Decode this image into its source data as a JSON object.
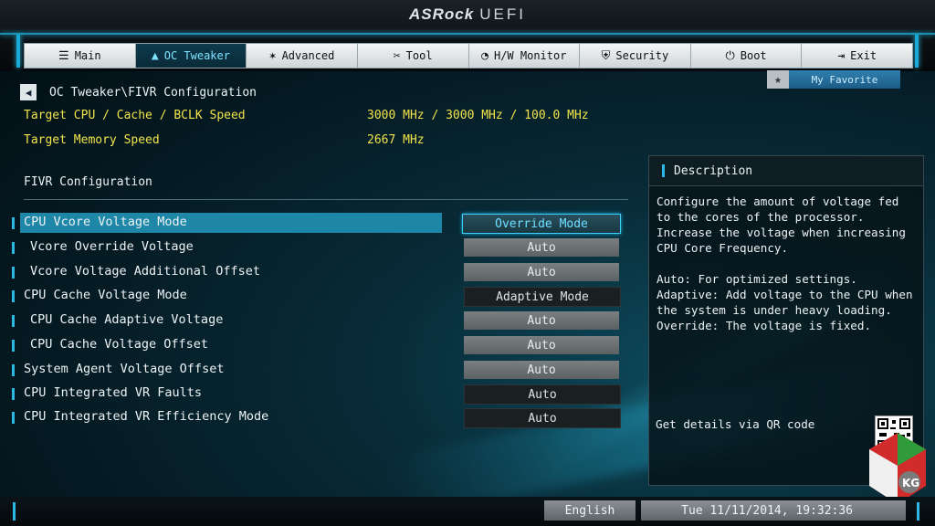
{
  "brand": {
    "logo_text": "ASRock",
    "product": "UEFI"
  },
  "tabs": [
    {
      "label": "Main",
      "icon": "list-icon",
      "glyph": "☰"
    },
    {
      "label": "OC Tweaker",
      "icon": "rocket-icon",
      "glyph": "🚀",
      "active": true
    },
    {
      "label": "Advanced",
      "icon": "star-icon",
      "glyph": "✶"
    },
    {
      "label": "Tool",
      "icon": "tools-icon",
      "glyph": "✂"
    },
    {
      "label": "H/W Monitor",
      "icon": "monitor-icon",
      "glyph": "◔"
    },
    {
      "label": "Security",
      "icon": "shield-icon",
      "glyph": "⛨"
    },
    {
      "label": "Boot",
      "icon": "power-icon",
      "glyph": "⏻"
    },
    {
      "label": "Exit",
      "icon": "exit-icon",
      "glyph": "⇥"
    }
  ],
  "favorite": {
    "label": "My Favorite",
    "icon": "star-icon"
  },
  "breadcrumb": "OC Tweaker\\FIVR Configuration",
  "info": [
    {
      "label": "Target CPU / Cache / BCLK Speed",
      "value": "3000 MHz / 3000 MHz / 100.0 MHz"
    },
    {
      "label": "Target Memory Speed",
      "value": "2667 MHz"
    }
  ],
  "section_title": "FIVR Configuration",
  "settings": [
    {
      "label": "CPU Vcore Voltage Mode",
      "value": "Override Mode"
    },
    {
      "label": "Vcore Override Voltage",
      "value": "Auto"
    },
    {
      "label": "Vcore Voltage Additional Offset",
      "value": "Auto"
    },
    {
      "label": "CPU Cache Voltage Mode",
      "value": "Adaptive Mode"
    },
    {
      "label": "CPU Cache Adaptive Voltage",
      "value": "Auto"
    },
    {
      "label": "CPU Cache Voltage Offset",
      "value": "Auto"
    },
    {
      "label": "System Agent Voltage Offset",
      "value": "Auto"
    },
    {
      "label": "CPU Integrated VR Faults",
      "value": "Auto"
    },
    {
      "label": "CPU Integrated VR Efficiency Mode",
      "value": "Auto"
    }
  ],
  "description": {
    "title": "Description",
    "paragraph1": "Configure the amount of voltage fed to the cores of the processor. Increase the voltage when increasing CPU Core Frequency.",
    "paragraph2_line1": "Auto: For optimized settings.",
    "paragraph2_line2": "Adaptive: Add voltage to the CPU when the system is under heavy loading.",
    "paragraph2_line3": "Override: The voltage is fixed.",
    "qr_text": "Get details via QR code"
  },
  "footer": {
    "language": "English",
    "datetime": "Tue 11/11/2014, 19:32:36"
  },
  "colors": {
    "accent": "#2cb7e4",
    "highlight": "#1e87a8",
    "info_text": "#f2e44a"
  }
}
